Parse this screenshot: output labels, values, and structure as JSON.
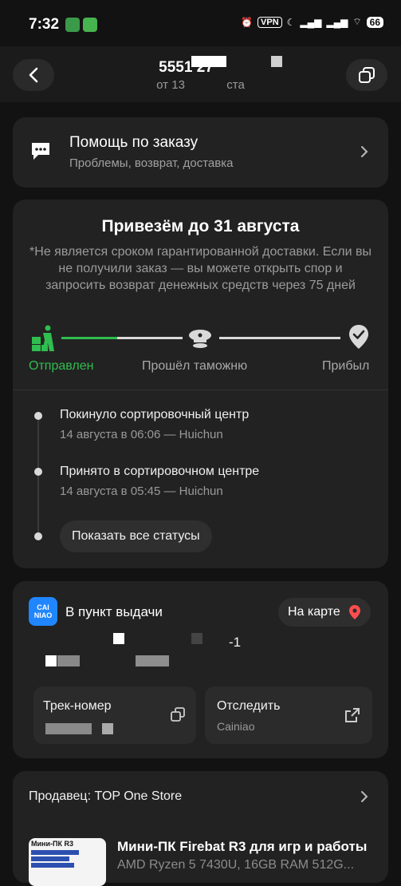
{
  "status_bar": {
    "time": "7:32",
    "vpn": "VPN",
    "battery": "66"
  },
  "header": {
    "order_number": "5551 27",
    "date_prefix": "от 13",
    "date_suffix": "ста"
  },
  "help": {
    "title": "Помощь по заказу",
    "subtitle": "Проблемы, возврат, доставка"
  },
  "delivery": {
    "title": "Привезём до 31 августа",
    "note": "*Не является сроком гарантированной доставки. Если вы не получили заказ — вы можете открыть спор и запросить возврат денежных средств через 75 дней",
    "steps": [
      {
        "label": "Отправлен",
        "active": true
      },
      {
        "label": "Прошёл таможню",
        "active": false
      },
      {
        "label": "Прибыл",
        "active": false
      }
    ],
    "progress_fraction": 0.2,
    "events": [
      {
        "title": "Покинуло сортировочный центр",
        "subtitle": "14 августа в 06:06 — Huichun"
      },
      {
        "title": "Принято в сортировочном центре",
        "subtitle": "14 августа в 05:45 — Huichun"
      }
    ],
    "show_all_label": "Показать все статусы"
  },
  "pickup": {
    "logo_line1": "CAI",
    "logo_line2": "NIAO",
    "title": "В пункт выдачи",
    "map_label": "На карте",
    "address_fragment": "-1",
    "track_label": "Трек-номер",
    "track_button": {
      "title": "Отследить",
      "subtitle": "Cainiao"
    }
  },
  "seller": {
    "label": "Продавец: TOP One Store"
  },
  "product": {
    "image_caption": "Мини-ПК R3",
    "title": "Мини-ПК Firebat R3 для игр и работы",
    "subtitle": "AMD Ryzen 5 7430U, 16GB RAM 512G..."
  },
  "colors": {
    "accent_green": "#2fbe4f",
    "background": "#121212",
    "card": "#222222",
    "map_pin": "#ff4d4f",
    "cainiao_blue": "#1f86ff"
  }
}
